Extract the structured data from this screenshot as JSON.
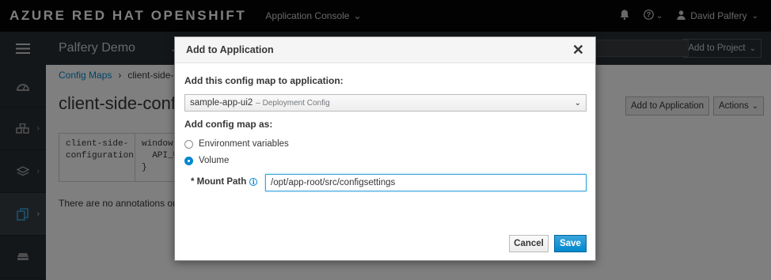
{
  "masthead": {
    "brand": "AZURE RED HAT OPENSHIFT",
    "app_menu": "Application Console",
    "user_name": "David Palfery",
    "icons": [
      "bell-icon",
      "help-icon",
      "user-icon"
    ]
  },
  "project_bar": {
    "project_name": "Palfery Demo",
    "add_to_project": "Add to Project"
  },
  "left_nav": {
    "items": [
      "dashboard-icon",
      "applications-icon",
      "builds-icon",
      "resources-icon",
      "storage-icon"
    ],
    "active_index": 3
  },
  "page": {
    "breadcrumb_parent": "Config Maps",
    "breadcrumb_current": "client-side-co",
    "title": "client-side-config",
    "add_to_application": "Add to Application",
    "actions": "Actions",
    "table": {
      "key": "client-side-\nconfiguration",
      "value": "window.\n  API_U\n}"
    },
    "annotations_text": "There are no annotations on th"
  },
  "modal": {
    "title": "Add to Application",
    "add_label": "Add this config map to application:",
    "selected_app": "sample-app-ui2",
    "selected_app_kind": "– Deployment Config",
    "add_as_label": "Add config map as:",
    "options": [
      "Environment variables",
      "Volume"
    ],
    "selected_option": "Volume",
    "mount_path_label": "* Mount Path",
    "mount_path_value": "/opt/app-root/src/configsettings",
    "cancel": "Cancel",
    "save": "Save"
  },
  "colors": {
    "masthead": "#050505",
    "nav": "#292e34",
    "primary": "#0088ce",
    "active_nav_icon": "#39a5dc"
  }
}
